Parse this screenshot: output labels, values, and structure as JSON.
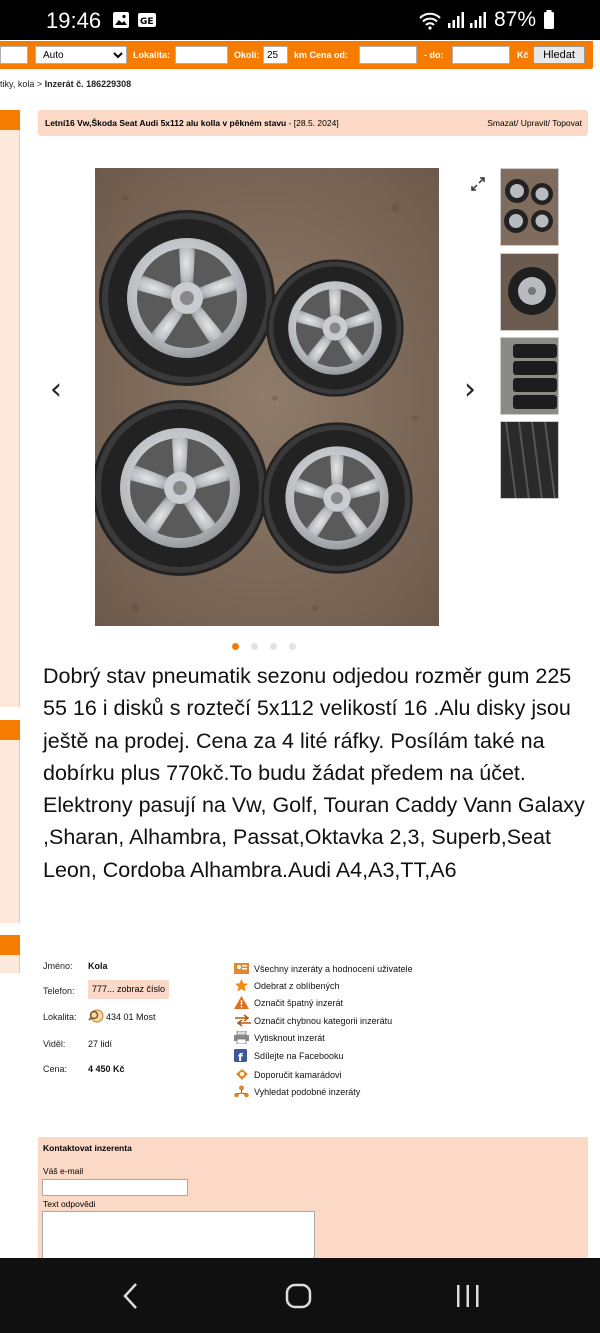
{
  "status_bar": {
    "time": "19:46",
    "battery": "87%",
    "icons": [
      "gallery-icon",
      "messages-icon",
      "wifi-icon",
      "signal-icon",
      "signal-icon"
    ]
  },
  "search": {
    "category_value": "Auto",
    "locality_label": "Lokalita:",
    "radius_label": "Okolí:",
    "radius_value": "25",
    "price_label": "km  Cena od:",
    "to_label": "- do:",
    "currency_label": "Kč",
    "button_label": "Hledat"
  },
  "breadcrumb": {
    "prefix": "tiky, kola > ",
    "current": "Inzerát č. 186229308"
  },
  "listing": {
    "title": "Letní16 Vw,Škoda Seat Audi 5x112 alu kolla v pěkném stavu",
    "date": " - [28.5. 2024]",
    "actions": "Smazat/ Upravit/ Topovat",
    "description": "Dobrý stav pneumatik sezonu odjedou rozměr gum 225 55 16 i disků s roztečí 5x112 velikostí 16 .Alu disky jsou ještě na prodej. Cena za 4 lité ráfky. Posílám také na dobírku plus 770kč.To budu žádat předem na účet. Elektrony pasují na Vw, Golf, Touran Caddy Vann Galaxy ,Sharan, Alhambra, Passat,Oktavka 2,3, Superb,Seat Leon, Cordoba Alhambra.Audi A4,A3,TT,A6"
  },
  "gallery": {
    "image_count": 4,
    "active_index": 0
  },
  "seller": {
    "name_label": "Jméno:",
    "name": "Kola",
    "phone_label": "Telefon:",
    "phone": "777... zobraz číslo",
    "locality_label": "Lokalita:",
    "locality": "434 01 Most",
    "views_label": "Viděl:",
    "views": "27 lidí",
    "price_label": "Cena:",
    "price": "4 450 Kč"
  },
  "actions": [
    {
      "icon": "user-listings-icon",
      "label": "Všechny inzeráty a hodnocení uživatele"
    },
    {
      "icon": "star-icon",
      "label": "Odebrat z oblíbených"
    },
    {
      "icon": "warning-icon",
      "label": "Označit špatný inzerát"
    },
    {
      "icon": "swap-arrows-icon",
      "label": "Označit chybnou kategorii inzerátu"
    },
    {
      "icon": "printer-icon",
      "label": "Vytisknout inzerát"
    },
    {
      "icon": "facebook-icon",
      "label": "Sdílejte na Facebooku"
    },
    {
      "icon": "recommend-icon",
      "label": "Doporučit kamarádovi"
    },
    {
      "icon": "similar-icon",
      "label": "Vyhledat podobné inzeráty"
    }
  ],
  "contact": {
    "title": "Kontaktovat inzerenta",
    "email_label": "Váš e-mail",
    "reply_label": "Text odpovědi"
  },
  "colors": {
    "accent": "#f57c00",
    "panel": "#fbd9c6"
  }
}
